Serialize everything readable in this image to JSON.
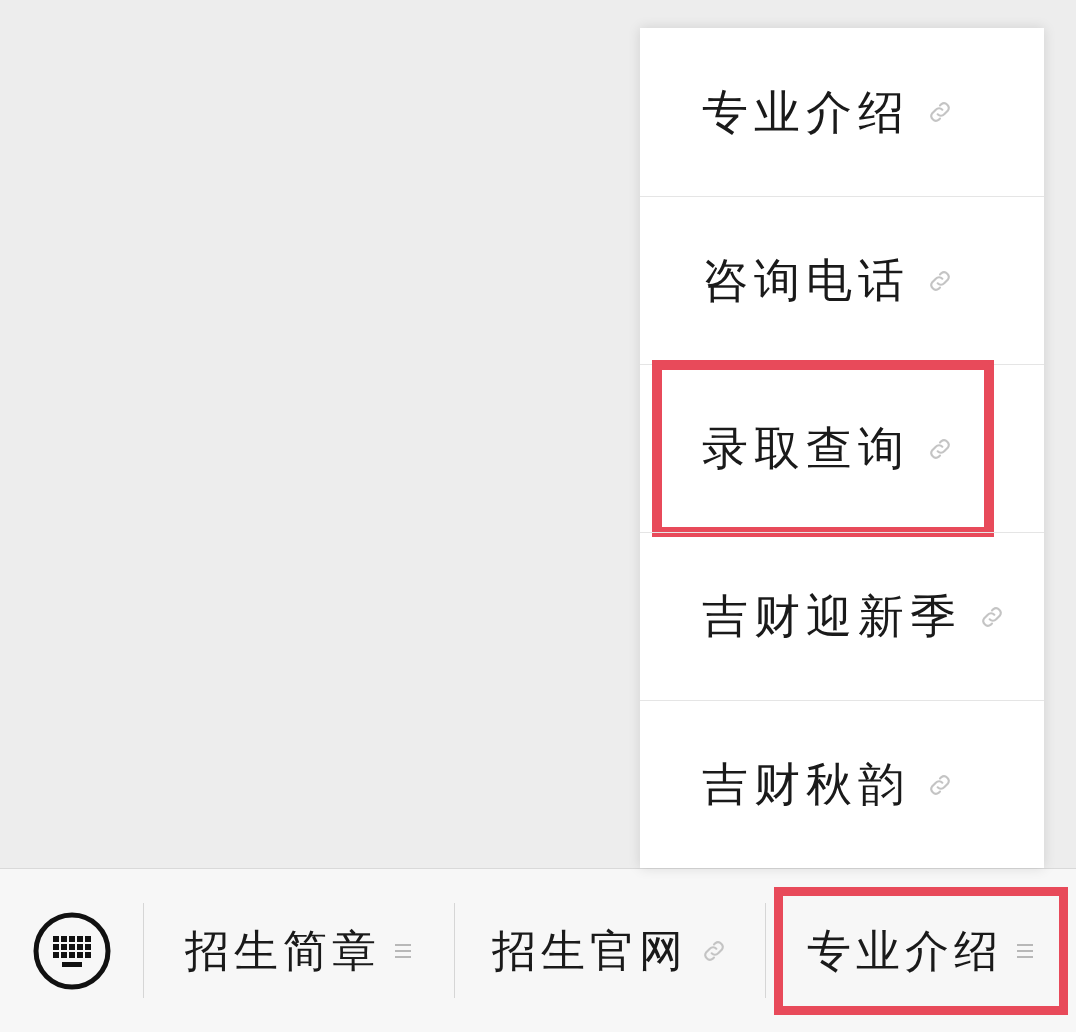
{
  "popup_menu": {
    "items": [
      {
        "label": "专业介绍",
        "highlighted": false
      },
      {
        "label": "咨询电话",
        "highlighted": false
      },
      {
        "label": "录取查询",
        "highlighted": true
      },
      {
        "label": "吉财迎新季",
        "highlighted": false
      },
      {
        "label": "吉财秋韵",
        "highlighted": false
      }
    ]
  },
  "bottom_menu": {
    "tabs": [
      {
        "label": "招生简章",
        "kind": "submenu",
        "highlighted": false
      },
      {
        "label": "招生官网",
        "kind": "link",
        "highlighted": false
      },
      {
        "label": "专业介绍",
        "kind": "submenu",
        "highlighted": true
      }
    ]
  }
}
